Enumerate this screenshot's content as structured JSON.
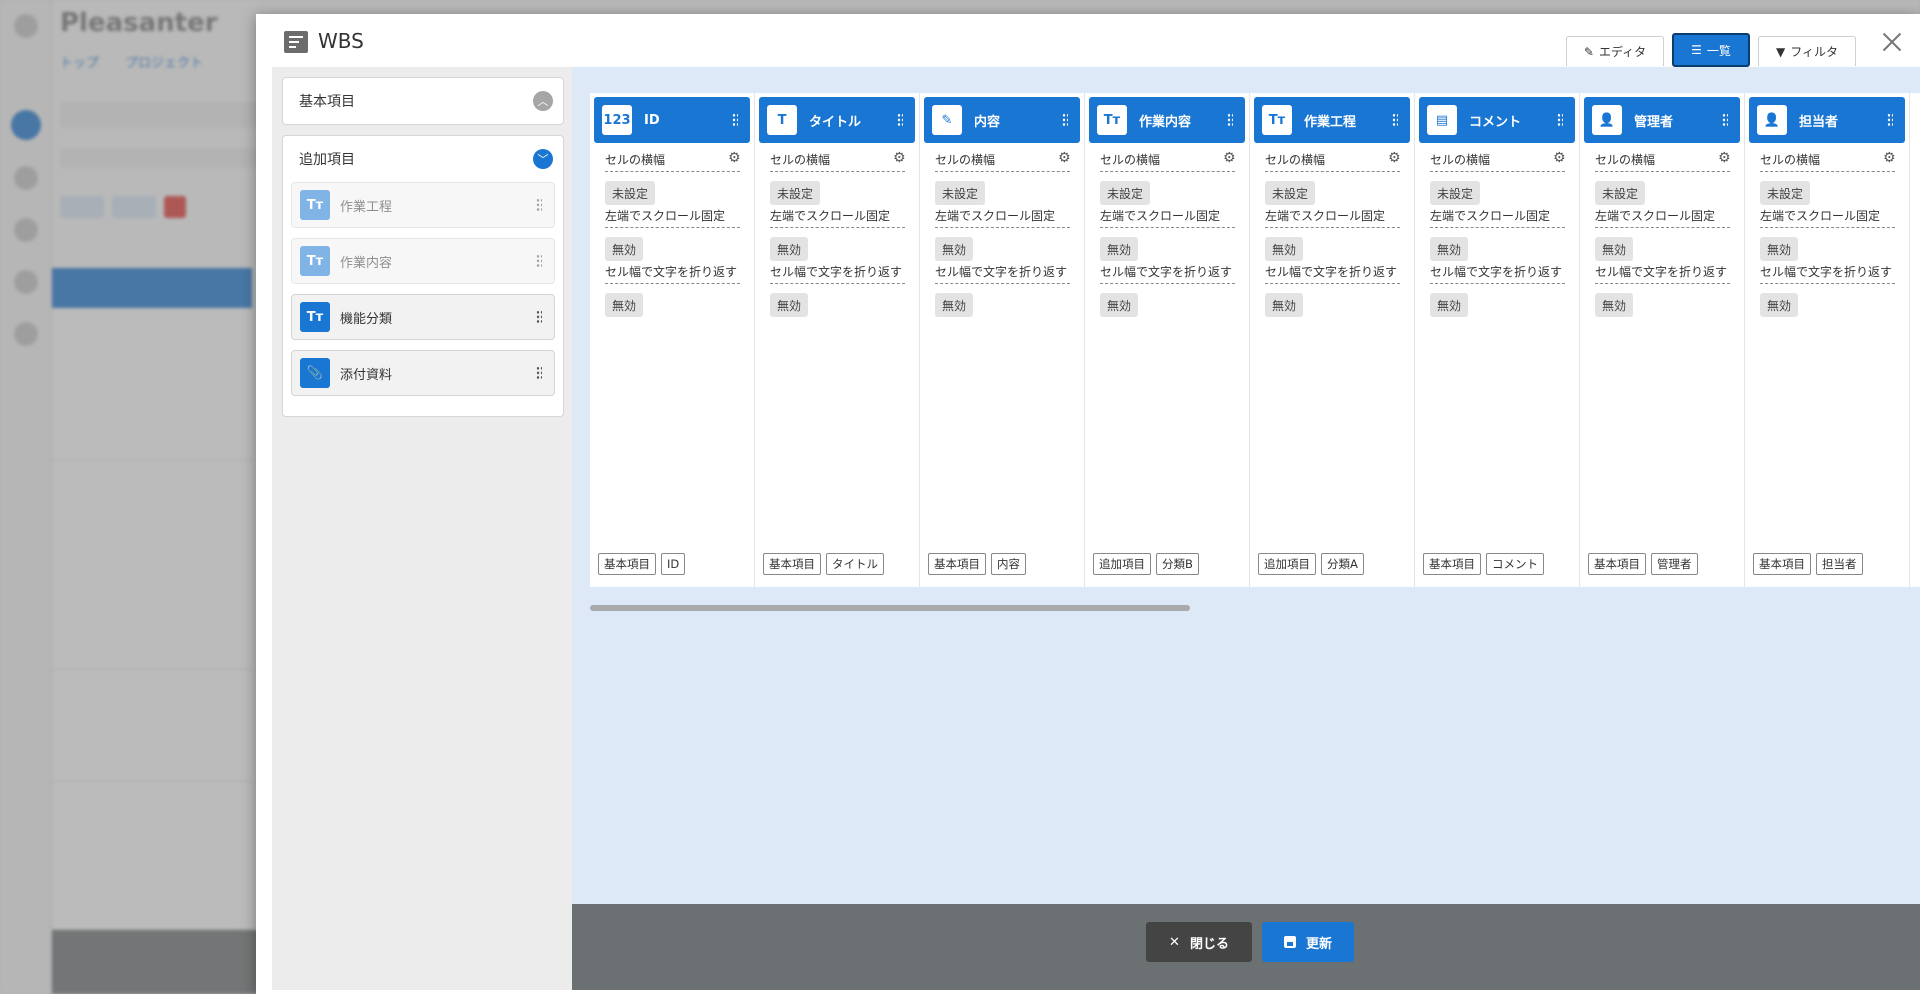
{
  "background_app": {
    "logo": "Pleasanter",
    "tabs": "トップ　　プロジェクト"
  },
  "modal": {
    "title": "WBS",
    "tabs": {
      "editor": "エディタ",
      "list": "一覧",
      "filter": "フィルタ"
    }
  },
  "left_panel": {
    "basic_section": {
      "label": "基本項目"
    },
    "additional_section": {
      "label": "追加項目",
      "items": [
        {
          "label": "作業工程",
          "icon": "Tт",
          "disabled": true
        },
        {
          "label": "作業内容",
          "icon": "Tт",
          "disabled": true
        },
        {
          "label": "機能分類",
          "icon": "Tт",
          "disabled": false
        },
        {
          "label": "添付資料",
          "icon": "paperclip-icon",
          "disabled": false
        }
      ]
    }
  },
  "columns": [
    {
      "title": "ID",
      "icon": "123",
      "props": [
        "未設定",
        "無効",
        "無効"
      ],
      "tags": [
        "基本項目",
        "ID"
      ]
    },
    {
      "title": "タイトル",
      "icon": "T",
      "props": [
        "未設定",
        "無効",
        "無効"
      ],
      "tags": [
        "基本項目",
        "タイトル"
      ]
    },
    {
      "title": "内容",
      "icon": "✎",
      "props": [
        "未設定",
        "無効",
        "無効"
      ],
      "tags": [
        "基本項目",
        "内容"
      ]
    },
    {
      "title": "作業内容",
      "icon": "Tт",
      "props": [
        "未設定",
        "無効",
        "無効"
      ],
      "tags": [
        "追加項目",
        "分類B"
      ]
    },
    {
      "title": "作業工程",
      "icon": "Tт",
      "props": [
        "未設定",
        "無効",
        "無効"
      ],
      "tags": [
        "追加項目",
        "分類A"
      ]
    },
    {
      "title": "コメント",
      "icon": "▤",
      "props": [
        "未設定",
        "無効",
        "無効"
      ],
      "tags": [
        "基本項目",
        "コメント"
      ]
    },
    {
      "title": "管理者",
      "icon": "👤",
      "props": [
        "未設定",
        "無効",
        "無効"
      ],
      "tags": [
        "基本項目",
        "管理者"
      ]
    },
    {
      "title": "担当者",
      "icon": "👤",
      "props": [
        "未設定",
        "無効",
        "無効"
      ],
      "tags": [
        "基本項目",
        "担当者"
      ]
    }
  ],
  "prop_labels": [
    "セルの横幅",
    "左端でスクロール固定",
    "セル幅で文字を折り返す"
  ],
  "footer": {
    "close_label": "閉じる",
    "update_label": "更新"
  },
  "colors": {
    "accent": "#1976d2",
    "footer": "#6b7073"
  }
}
